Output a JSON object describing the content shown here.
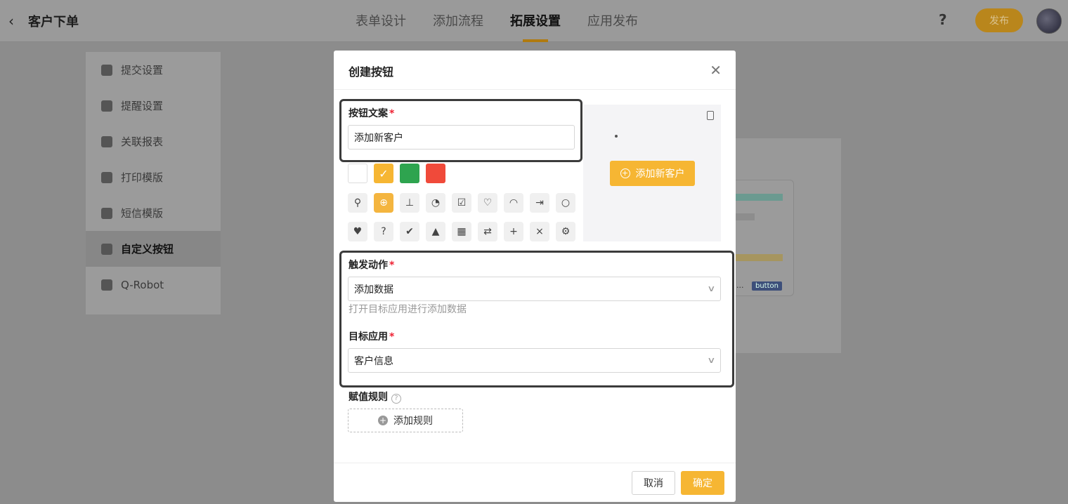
{
  "header": {
    "back_icon": "chevron-left-icon",
    "title": "客户下单",
    "tabs": [
      {
        "label": "表单设计",
        "active": false
      },
      {
        "label": "添加流程",
        "active": false
      },
      {
        "label": "拓展设置",
        "active": true
      },
      {
        "label": "应用发布",
        "active": false
      }
    ],
    "help": "?",
    "publish_label": "发布"
  },
  "sidebar": {
    "items": [
      {
        "label": "提交设置",
        "icon": "send-icon"
      },
      {
        "label": "提醒设置",
        "icon": "bell-icon"
      },
      {
        "label": "关联报表",
        "icon": "report-icon"
      },
      {
        "label": "打印模版",
        "icon": "printer-icon"
      },
      {
        "label": "短信模版",
        "icon": "message-icon"
      },
      {
        "label": "自定义按钮",
        "icon": "button-icon",
        "active": true
      },
      {
        "label": "Q-Robot",
        "icon": "robot-icon"
      }
    ]
  },
  "background": {
    "tag": "button",
    "dots": "..."
  },
  "modal": {
    "title": "创建按钮",
    "close_icon": "close-icon",
    "button_text_label": "按钮文案",
    "button_text_value": "添加新客户",
    "colors": [
      "#ffffff",
      "#f6b633",
      "#2ea44f",
      "#f04a3a"
    ],
    "selected_color": "#f6b633",
    "icons_row1": [
      "wrench-icon",
      "plus-circle-icon",
      "stamp-icon",
      "pie-chart-icon",
      "edit-icon",
      "heart-outline-icon",
      "loading-icon",
      "export-icon",
      "search-icon"
    ],
    "icons_row2": [
      "heart-icon",
      "question-icon",
      "check-circle-icon",
      "stamp-solid-icon",
      "report-icon",
      "exchange-icon",
      "add-circle-icon",
      "close-circle-icon",
      "settings-icon"
    ],
    "preview_button_label": "添加新客户",
    "trigger_label": "触发动作",
    "trigger_value": "添加数据",
    "trigger_hint": "打开目标应用进行添加数据",
    "target_label": "目标应用",
    "target_value": "客户信息",
    "assign_label": "赋值规则",
    "add_rule_label": "添加规则",
    "cancel_label": "取消",
    "ok_label": "确定"
  }
}
